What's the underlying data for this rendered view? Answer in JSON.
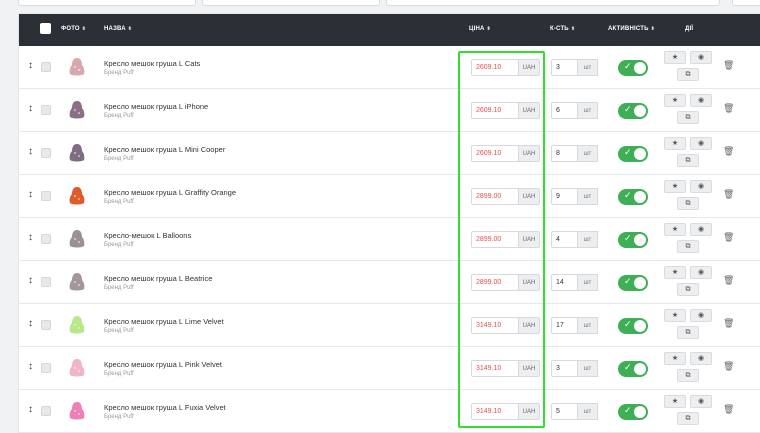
{
  "header": {
    "photo": "ФОТО",
    "name": "НАЗВА",
    "price": "ЦІНА",
    "qty": "К-СТЬ",
    "active": "АКТИВНІСТЬ",
    "actions": "ДІЇ"
  },
  "rows": [
    {
      "name": "Кресло мешок груша L Cats",
      "brand": "Бренд Puff",
      "price": "2609.10",
      "currency": "UAH",
      "qty": "3",
      "unit": "шт",
      "thumb": "#d9a8ae"
    },
    {
      "name": "Кресло мешок груша L iPhone",
      "brand": "Бренд Puff",
      "price": "2609.10",
      "currency": "UAH",
      "qty": "6",
      "unit": "шт",
      "thumb": "#8b6f85"
    },
    {
      "name": "Кресло мешок груша L Mini Cooper",
      "brand": "Бренд Puff",
      "price": "2609.10",
      "currency": "UAH",
      "qty": "8",
      "unit": "шт",
      "thumb": "#7d6e80"
    },
    {
      "name": "Кресло мешок груша L Graffity Orange",
      "brand": "Бренд Puff",
      "price": "2899.00",
      "currency": "UAH",
      "qty": "9",
      "unit": "шт",
      "thumb": "#e05a2a"
    },
    {
      "name": "Кресло-мешок L Balloons",
      "brand": "Бренд Puff",
      "price": "2899.00",
      "currency": "UAH",
      "qty": "4",
      "unit": "шт",
      "thumb": "#9c8f98"
    },
    {
      "name": "Кресло мешок груша L Beatrice",
      "brand": "Бренд Puff",
      "price": "2899.00",
      "currency": "UAH",
      "qty": "14",
      "unit": "шт",
      "thumb": "#a39799"
    },
    {
      "name": "Кресло мешок груша L Lime Velvet",
      "brand": "Бренд Puff",
      "price": "3149.10",
      "currency": "UAH",
      "qty": "17",
      "unit": "шт",
      "thumb": "#b8e88a"
    },
    {
      "name": "Кресло мешок груша L Pink Velvet",
      "brand": "Бренд Puff",
      "price": "3149.10",
      "currency": "UAH",
      "qty": "3",
      "unit": "шт",
      "thumb": "#f0b3c8"
    },
    {
      "name": "Кресло мешок груша L Fuxia Velvet",
      "brand": "Бренд Puff",
      "price": "3149.10",
      "currency": "UAH",
      "qty": "5",
      "unit": "шт",
      "thumb": "#f07fb5"
    }
  ],
  "icons": {
    "drag": "↕",
    "star": "★",
    "eye": "◉",
    "copy": "⧉",
    "trash": "🗑",
    "check": "✓"
  },
  "colors": {
    "header_bg": "#2b3037",
    "price_text": "#e05050",
    "toggle_on": "#3eaf55",
    "highlight": "#2fe02f"
  }
}
